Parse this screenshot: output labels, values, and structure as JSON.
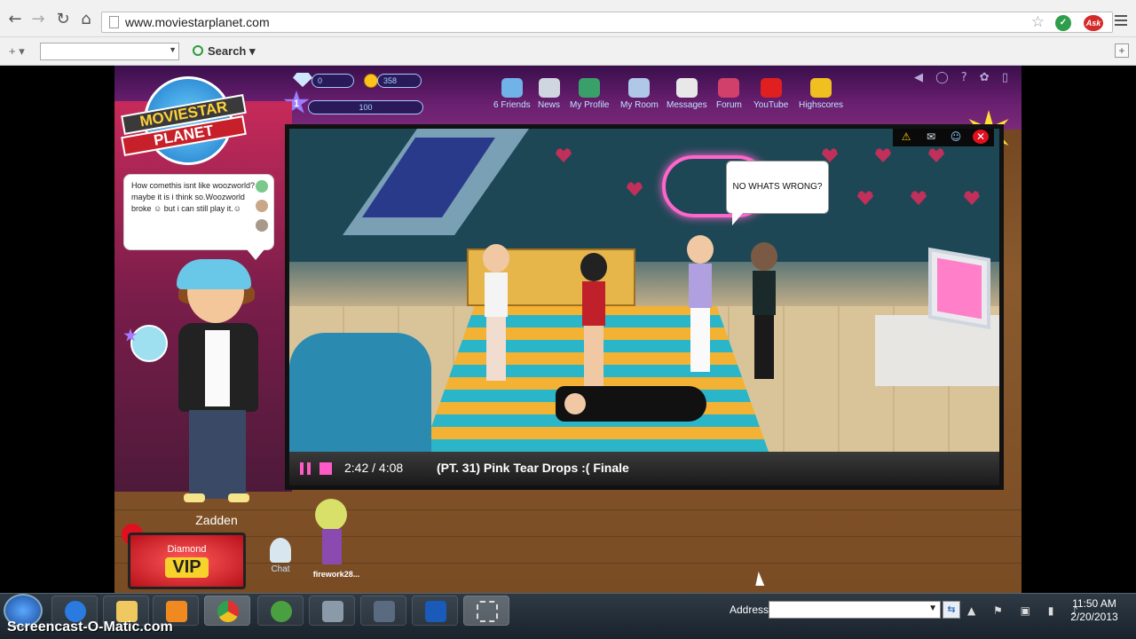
{
  "browser": {
    "url": "www.moviestarplanet.com",
    "back_icon": "←",
    "forward_icon": "→",
    "reload_icon": "↻",
    "home_icon": "⌂",
    "star_icon": "☆",
    "ext1_label": "✓",
    "ext2_label": "Ask",
    "toolbar_add_label": "+ ▾",
    "search_label": "Search ▾",
    "toolbar_plus": "+"
  },
  "game": {
    "diamonds": "0",
    "coins": "358",
    "level": "1",
    "fame": "100",
    "nav": [
      {
        "label": "6 Friends",
        "color": "#6fb3e8"
      },
      {
        "label": "News",
        "color": "#cfd6e0"
      },
      {
        "label": "My Profile",
        "color": "#3aa06a"
      },
      {
        "label": "My Room",
        "color": "#b0c8e8"
      },
      {
        "label": "Messages",
        "color": "#e8e8e8"
      },
      {
        "label": "Forum",
        "color": "#d0406a"
      },
      {
        "label": "YouTube",
        "color": "#e02020"
      },
      {
        "label": "Highscores",
        "color": "#f0c020"
      }
    ],
    "top_controls": "◀ ◯ ? ✿ ▯",
    "logo_line1": "MOVIESTAR",
    "logo_line2": "PLANET",
    "chat_message": "How comethis isnt like woozworld? maybe it is i think so.Woozworld broke ☺ but i can still play it.☺",
    "username": "Zadden",
    "vip_line1": "Diamond",
    "vip_line2": "VIP",
    "chat_label": "Chat",
    "other_user": "firework28..."
  },
  "video": {
    "time": "2:42 / 4:08",
    "title": "(PT. 31) Pink Tear Drops :( Finale",
    "speech": "NO WHATS WRONG?",
    "icons": {
      "warning": "⚠",
      "mail": "✉",
      "people": "☺",
      "close": "✕"
    }
  },
  "taskbar": {
    "address_label": "Address",
    "tray": "▲ ⚑ ▣ ▮ ♪",
    "time": "11:50 AM",
    "date": "2/20/2013",
    "go_icon": "⇆"
  },
  "watermark": "Screencast-O-Matic.com"
}
